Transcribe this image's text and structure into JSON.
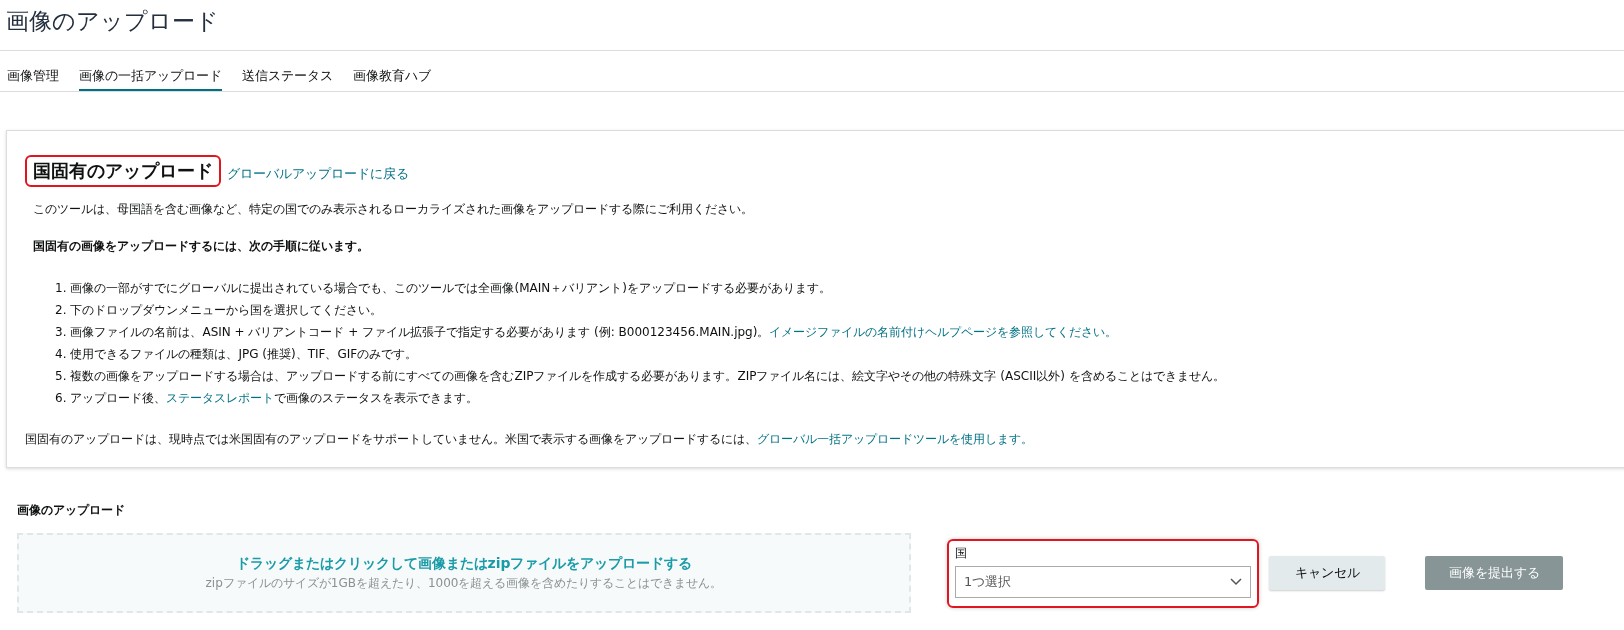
{
  "page_title": "画像のアップロード",
  "tabs": [
    {
      "label": "画像管理",
      "selected": false
    },
    {
      "label": "画像の一括アップロード",
      "selected": true
    },
    {
      "label": "送信ステータス",
      "selected": false
    },
    {
      "label": "画像教育ハブ",
      "selected": false
    }
  ],
  "info_panel": {
    "heading": "国固有のアップロード",
    "heading_highlighted": true,
    "back_link": "グローバルアップロードに戻る",
    "intro": "このツールは、母国語を含む画像など、特定の国でのみ表示されるローカライズされた画像をアップロードする際にご利用ください。",
    "steps_title": "国固有の画像をアップロードするには、次の手順に従います。",
    "steps": [
      {
        "number": "1.",
        "parts": [
          {
            "text": "画像の一部がすでにグローバルに提出されている場合でも、このツールでは全画像(MAIN＋バリアント)をアップロードする必要があります。",
            "kind": "text"
          }
        ]
      },
      {
        "number": "2.",
        "parts": [
          {
            "text": "下のドロップダウンメニューから国を選択してください。",
            "kind": "text"
          }
        ]
      },
      {
        "number": "3.",
        "parts": [
          {
            "text": "画像ファイルの名前は、ASIN + バリアントコード + ファイル拡張子で指定する必要があります (例: B000123456.MAIN.jpg)。",
            "kind": "text"
          },
          {
            "text": "イメージファイルの名前付けヘルプページを参照してください。",
            "kind": "link"
          }
        ]
      },
      {
        "number": "4.",
        "parts": [
          {
            "text": "使用できるファイルの種類は、JPG (推奨)、TIF、GIFのみです。",
            "kind": "text"
          }
        ]
      },
      {
        "number": "5.",
        "parts": [
          {
            "text": "複数の画像をアップロードする場合は、アップロードする前にすべての画像を含むZIPファイルを作成する必要があります。ZIPファイル名には、絵文字やその他の特殊文字 (ASCII以外) を含めることはできません。",
            "kind": "text"
          }
        ]
      },
      {
        "number": "6.",
        "parts": [
          {
            "text": "アップロード後、",
            "kind": "text"
          },
          {
            "text": "ステータスレポート",
            "kind": "link"
          },
          {
            "text": "で画像のステータスを表示できます。",
            "kind": "text"
          }
        ]
      }
    ],
    "note": [
      {
        "text": "国固有のアップロードは、現時点では米国固有のアップロードをサポートしていません。米国で表示する画像をアップロードするには、",
        "kind": "text"
      },
      {
        "text": "グローバル一括アップロードツールを使用します。",
        "kind": "link"
      }
    ]
  },
  "upload": {
    "label": "画像のアップロード",
    "drop_title": "ドラッグまたはクリックして画像またはzipファイルをアップロードする",
    "drop_hint": "zipファイルのサイズが1GBを超えたり、1000を超える画像を含めたりすることはできません。",
    "country": {
      "label": "国",
      "value": "1つ選択",
      "highlighted": true
    },
    "buttons": [
      {
        "label": "キャンセル",
        "kind": "secondary",
        "disabled": false
      },
      {
        "label": "画像を提出する",
        "kind": "primary",
        "disabled": true
      }
    ]
  }
}
